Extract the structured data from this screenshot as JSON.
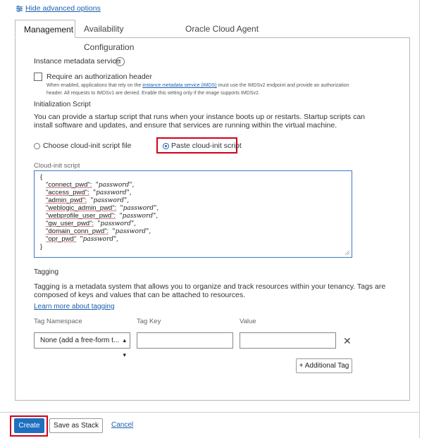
{
  "top": {
    "advanced_link": "Hide advanced options"
  },
  "tabs": [
    {
      "label": "Management"
    },
    {
      "label": "Availability Configuration"
    },
    {
      "label": "Oracle Cloud Agent"
    }
  ],
  "metadata": {
    "heading": "Instance metadata service",
    "checkbox_label": "Require an authorization header",
    "help_line1_pre": "When enabled, applications that rely on the ",
    "help_link": "instance metadata service (IMDS)",
    "help_line1_post": " must use the IMDSv2 endpoint and provide an authorization",
    "help_line2": "header. All requests to IMDSv1 are denied. Enable this setting only if the image supports IMDSv2."
  },
  "init_script": {
    "heading": "Initialization Script",
    "desc1": "You can provide a startup script that runs when your instance boots up or restarts. Startup scripts can",
    "desc2": "install software and updates, and ensure that services are running within the virtual machine.",
    "option_choose": "Choose cloud-init script file",
    "option_paste": "Paste cloud-init script",
    "selected": "Paste cloud-init script",
    "field_label": "Cloud-init script",
    "open_brace": "{",
    "close_brace": "}",
    "lines": [
      {
        "key": "\"connect_pwd\":",
        "val": "\"password\","
      },
      {
        "key": "\"access_pwd\":",
        "val": "\"password\","
      },
      {
        "key": "\"admin_pwd\":",
        "val": "\"password\","
      },
      {
        "key": "\"weblogic_admin_pwd\":",
        "val": "\"password\","
      },
      {
        "key": "\"webprofile_user_pwd\":",
        "val": "\"password\","
      },
      {
        "key": "\"gw_user_pwd\":",
        "val": "\"password\","
      },
      {
        "key": "\"domain_conn_pwd\":",
        "val": "\"password\","
      },
      {
        "key": "\"opr_pwd\"",
        "val": "\"password\","
      }
    ]
  },
  "tagging": {
    "heading": "Tagging",
    "desc1": "Tagging is a metadata system that allows you to organize and track resources within your tenancy. Tags are",
    "desc2": "composed of keys and values that can be attached to resources.",
    "learn_link": "Learn more about tagging",
    "col_namespace": "Tag Namespace",
    "col_key": "Tag Key",
    "col_value": "Value",
    "namespace_value": "None (add a free-form t...",
    "add_button": "+ Additional Tag"
  },
  "footer": {
    "create": "Create",
    "save_stack": "Save as Stack",
    "cancel": "Cancel"
  },
  "colors": {
    "primary": "#1f6fbf",
    "link": "#1a5fad",
    "highlight": "#d0021b"
  }
}
